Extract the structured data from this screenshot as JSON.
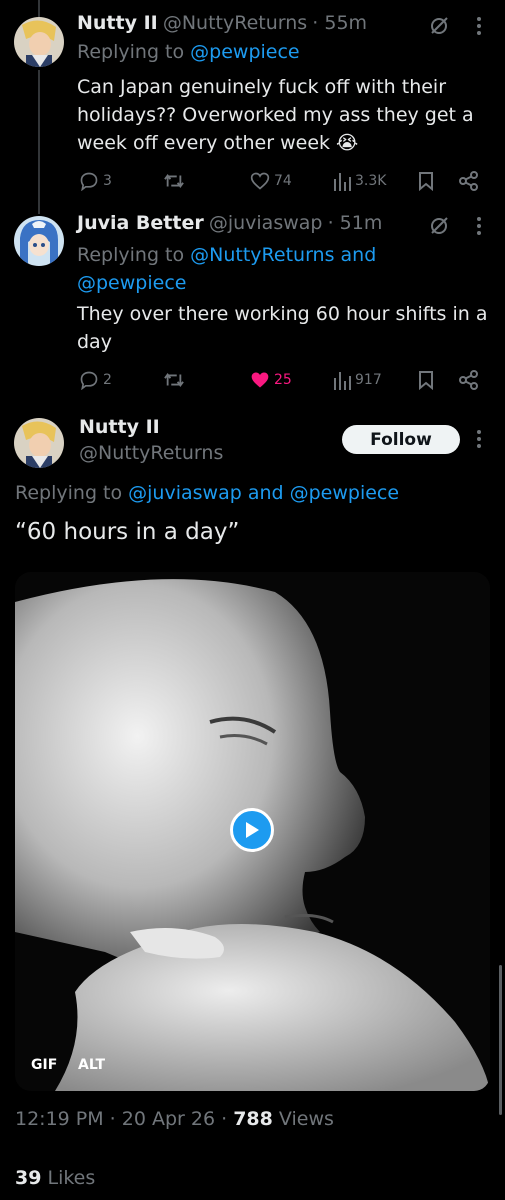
{
  "tweets": [
    {
      "display_name": "Nutty II",
      "handle": "@NuttyReturns",
      "time": "· 55m",
      "replying_prefix": "Replying to ",
      "replying_to": "@pewpiece",
      "text": "Can Japan genuinely fuck off with their holidays?? Overworked my ass they get a week off every other week 😭",
      "replies": "3",
      "retweets": "",
      "likes": "74",
      "views": "3.3K"
    },
    {
      "display_name": "Juvia Better",
      "handle": "@juviaswap",
      "time": "· 51m",
      "replying_prefix": "Replying to ",
      "replying_to": "@NuttyReturns and",
      "replying_to_2": "@pewpiece",
      "text": "They over there working 60 hour shifts in a day",
      "replies": "2",
      "retweets": "",
      "likes": "25",
      "views": "917"
    }
  ],
  "main_tweet": {
    "display_name": "Nutty II",
    "handle": "@NuttyReturns",
    "follow_label": "Follow",
    "replying_prefix": "Replying to ",
    "replying_to": "@juviaswap and @pewpiece",
    "text": "“60 hours in a day”",
    "media": {
      "gif_label": "GIF",
      "alt_label": "ALT"
    },
    "time": "12:19 PM · 20 Apr 26 · ",
    "views_count": "788",
    "views_label": " Views",
    "likes_count": "39",
    "likes_label": " Likes"
  },
  "colors": {
    "accent": "#1d9bf0",
    "like": "#f91880",
    "muted": "#71767b",
    "text": "#e7e9ea"
  }
}
